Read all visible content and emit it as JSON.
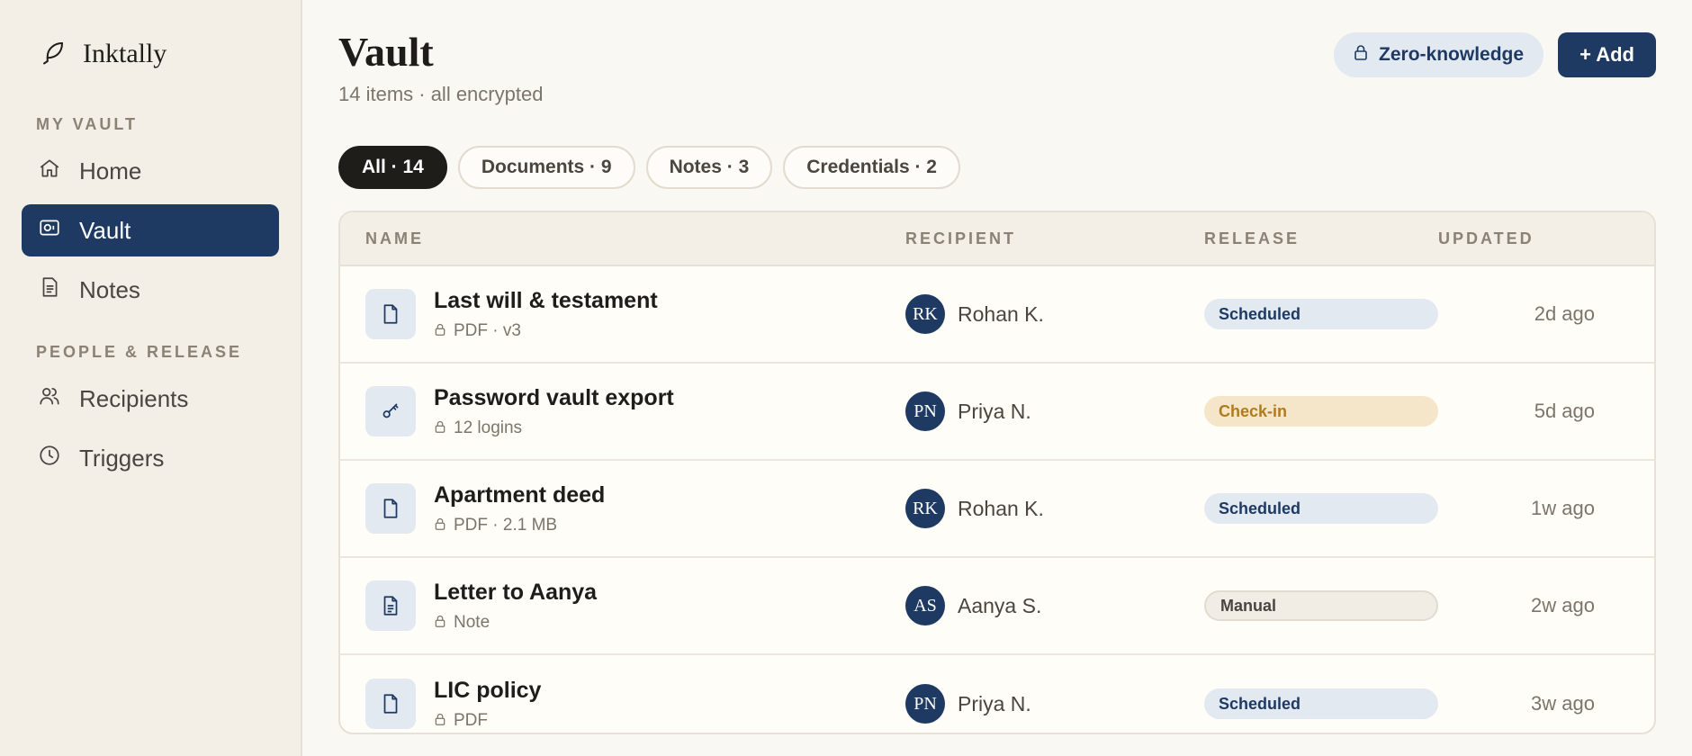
{
  "app": {
    "name": "Inktally"
  },
  "sidebar": {
    "sections": [
      {
        "label": "MY VAULT",
        "items": [
          {
            "label": "Home",
            "icon": "home-icon"
          },
          {
            "label": "Vault",
            "icon": "vault-icon",
            "active": true
          },
          {
            "label": "Notes",
            "icon": "notes-icon"
          }
        ]
      },
      {
        "label": "PEOPLE & RELEASE",
        "items": [
          {
            "label": "Recipients",
            "icon": "users-icon"
          },
          {
            "label": "Triggers",
            "icon": "clock-icon"
          }
        ]
      }
    ]
  },
  "header": {
    "title": "Vault",
    "subtitle": "14 items · all encrypted",
    "zk_label": "Zero-knowledge",
    "add_label": "+ Add"
  },
  "filters": [
    {
      "label": "All · 14",
      "active": true
    },
    {
      "label": "Documents · 9"
    },
    {
      "label": "Notes · 3"
    },
    {
      "label": "Credentials · 2"
    }
  ],
  "table": {
    "columns": [
      "NAME",
      "RECIPIENT",
      "RELEASE",
      "UPDATED"
    ],
    "rows": [
      {
        "title": "Last will & testament",
        "meta": "PDF · v3",
        "icon": "document-icon",
        "initials": "RK",
        "recipient": "Rohan K.",
        "release": "Scheduled",
        "release_type": "scheduled",
        "updated": "2d ago"
      },
      {
        "title": "Password vault export",
        "meta": "12 logins",
        "icon": "key-icon",
        "initials": "PN",
        "recipient": "Priya N.",
        "release": "Check-in",
        "release_type": "checkin",
        "updated": "5d ago"
      },
      {
        "title": "Apartment deed",
        "meta": "PDF · 2.1 MB",
        "icon": "document-icon",
        "initials": "RK",
        "recipient": "Rohan K.",
        "release": "Scheduled",
        "release_type": "scheduled",
        "updated": "1w ago"
      },
      {
        "title": "Letter to Aanya",
        "meta": "Note",
        "icon": "note-icon",
        "initials": "AS",
        "recipient": "Aanya S.",
        "release": "Manual",
        "release_type": "manual",
        "updated": "2w ago"
      },
      {
        "title": "LIC policy",
        "meta": "PDF",
        "icon": "document-icon",
        "initials": "PN",
        "recipient": "Priya N.",
        "release": "Scheduled",
        "release_type": "scheduled",
        "updated": "3w ago"
      }
    ]
  },
  "colors": {
    "accent": "#1e3a63",
    "background": "#faf8f3",
    "sidebar": "#f3efe7"
  }
}
